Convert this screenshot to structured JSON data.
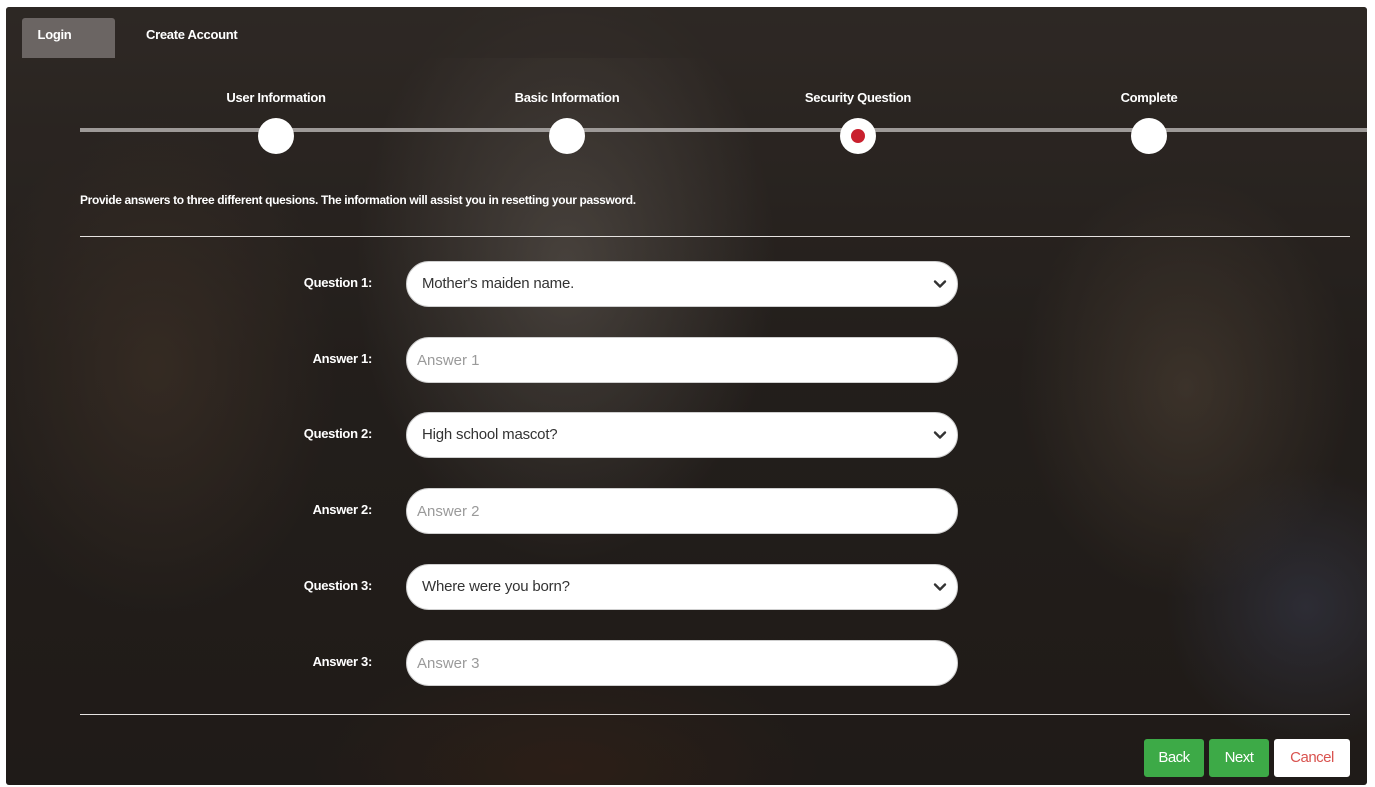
{
  "tabs": {
    "login": "Login",
    "create_account": "Create Account"
  },
  "steps": [
    {
      "label": "User Information",
      "state": "done"
    },
    {
      "label": "Basic Information",
      "state": "done"
    },
    {
      "label": "Security Question",
      "state": "active"
    },
    {
      "label": "Complete",
      "state": "pending"
    }
  ],
  "instruction": "Provide answers to three different quesions. The information will assist you in resetting your password.",
  "form": {
    "question1": {
      "label": "Question 1:",
      "value": "Mother's maiden name."
    },
    "answer1": {
      "label": "Answer 1:",
      "placeholder": "Answer 1",
      "value": ""
    },
    "question2": {
      "label": "Question 2:",
      "value": "High school mascot?"
    },
    "answer2": {
      "label": "Answer 2:",
      "placeholder": "Answer 2",
      "value": ""
    },
    "question3": {
      "label": "Question 3:",
      "value": "Where were you born?"
    },
    "answer3": {
      "label": "Answer 3:",
      "placeholder": "Answer 3",
      "value": ""
    }
  },
  "buttons": {
    "back": "Back",
    "next": "Next",
    "cancel": "Cancel"
  },
  "colors": {
    "success": "#3daa47",
    "danger": "#d9534f",
    "active_step": "#c9202e"
  },
  "icons": {
    "select_arrow": "chevron-down-icon"
  }
}
